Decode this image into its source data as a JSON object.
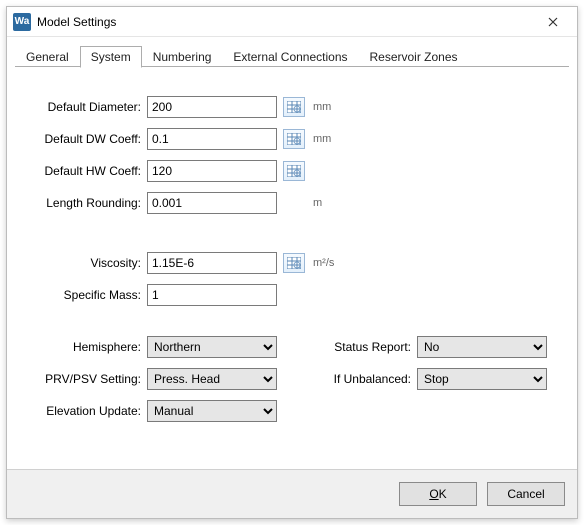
{
  "window": {
    "app_icon_text": "Wa",
    "title": "Model Settings"
  },
  "tabs": {
    "general": "General",
    "system": "System",
    "numbering": "Numbering",
    "external": "External Connections",
    "reservoir": "Reservoir Zones"
  },
  "fields": {
    "default_diameter": {
      "label": "Default Diameter:",
      "value": "200",
      "unit": "mm"
    },
    "default_dw": {
      "label": "Default DW Coeff:",
      "value": "0.1",
      "unit": "mm"
    },
    "default_hw": {
      "label": "Default HW Coeff:",
      "value": "120",
      "unit": ""
    },
    "length_round": {
      "label": "Length Rounding:",
      "value": "0.001",
      "unit": "m"
    },
    "viscosity": {
      "label": "Viscosity:",
      "value": "1.15E-6",
      "unit": "m²/s"
    },
    "specific_mass": {
      "label": "Specific Mass:",
      "value": "1",
      "unit": ""
    },
    "hemisphere": {
      "label": "Hemisphere:",
      "value": "Northern"
    },
    "prv_psv": {
      "label": "PRV/PSV Setting:",
      "value": "Press. Head"
    },
    "elev_update": {
      "label": "Elevation Update:",
      "value": "Manual"
    },
    "status_report": {
      "label": "Status Report:",
      "value": "No"
    },
    "if_unbalanced": {
      "label": "If Unbalanced:",
      "value": "Stop"
    }
  },
  "footer": {
    "ok": "OK",
    "cancel": "Cancel"
  }
}
